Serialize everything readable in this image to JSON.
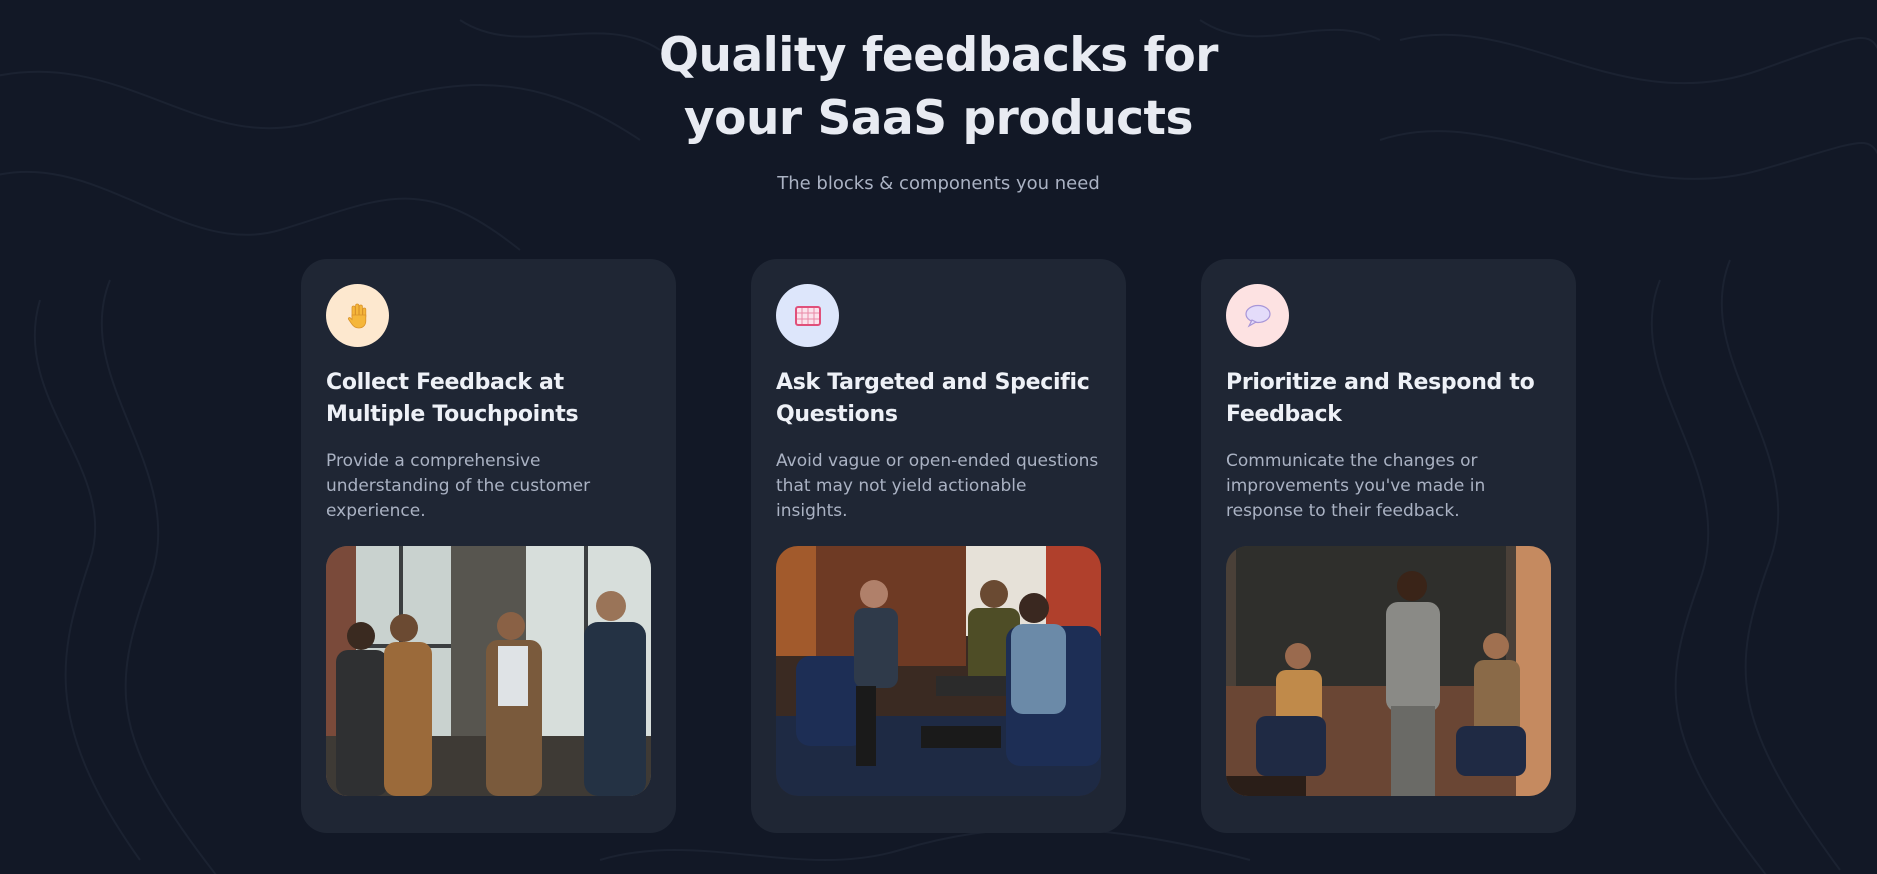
{
  "header": {
    "title_line1": "Quality feedbacks for",
    "title_line2": "your SaaS products",
    "subtitle": "The blocks & components you need"
  },
  "cards": [
    {
      "icon": "raised-hand-icon",
      "badge_color": "#fde8cf",
      "title": "Collect Feedback at Multiple Touchpoints",
      "description": "Provide a comprehensive understanding of the customer experience.",
      "image": "group-of-men-in-suits-talking-by-window"
    },
    {
      "icon": "goal-net-icon",
      "badge_color": "#dde6fb",
      "title": "Ask Targeted and Specific Questions",
      "description": "Avoid vague or open-ended questions that may not yield actionable insights.",
      "image": "panel-discussion-on-chairs"
    },
    {
      "icon": "speech-bubble-icon",
      "badge_color": "#fde2e2",
      "title": "Prioritize and Respond to Feedback",
      "description": "Communicate the changes or improvements you've made in response to their feedback.",
      "image": "speaker-with-microphone-on-stage"
    }
  ],
  "colors": {
    "background": "#121826",
    "card": "#1f2634",
    "title": "#e8ebf2",
    "muted_text": "#aab2c3"
  }
}
